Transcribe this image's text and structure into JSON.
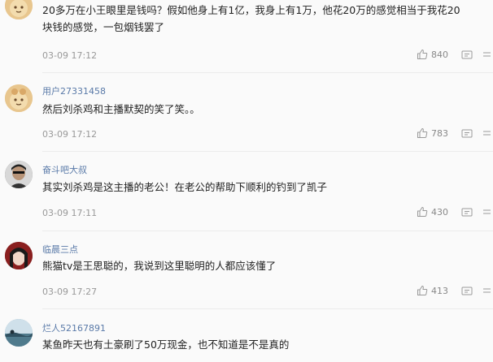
{
  "comments": [
    {
      "username": "",
      "text": "20多万在小王眼里是钱吗？假如他身上有1亿，我身上有1万，他花20万的感觉相当于我花20\n块钱的感觉，一包烟钱罢了",
      "time": "03-09 17:12",
      "likes": "840",
      "avatar_color": "#e8c68e"
    },
    {
      "username": "用户27331458",
      "text": "然后刘杀鸡和主播默契的笑了笑。。",
      "time": "03-09 17:12",
      "likes": "783",
      "avatar_color": "#e8c68e"
    },
    {
      "username": "奋斗吧大叔",
      "text": "其实刘杀鸡是这主播的老公！在老公的帮助下顺利的钓到了凯子",
      "time": "03-09 17:11",
      "likes": "430",
      "avatar_color": "#6b6b6b"
    },
    {
      "username": "临晨三点",
      "text": "熊猫tv是王思聪的，我说到这里聪明的人都应该懂了",
      "time": "03-09 17:27",
      "likes": "413",
      "avatar_color": "#7a2020"
    },
    {
      "username": "烂人52167891",
      "text": "某鱼昨天也有土豪刷了50万现金，也不知道是不是真的",
      "time": "",
      "likes": "",
      "avatar_color": "#7fa6b8"
    }
  ],
  "icons": {
    "like": "thumbs-up-icon",
    "reply": "comment-icon",
    "more": "more-icon"
  }
}
